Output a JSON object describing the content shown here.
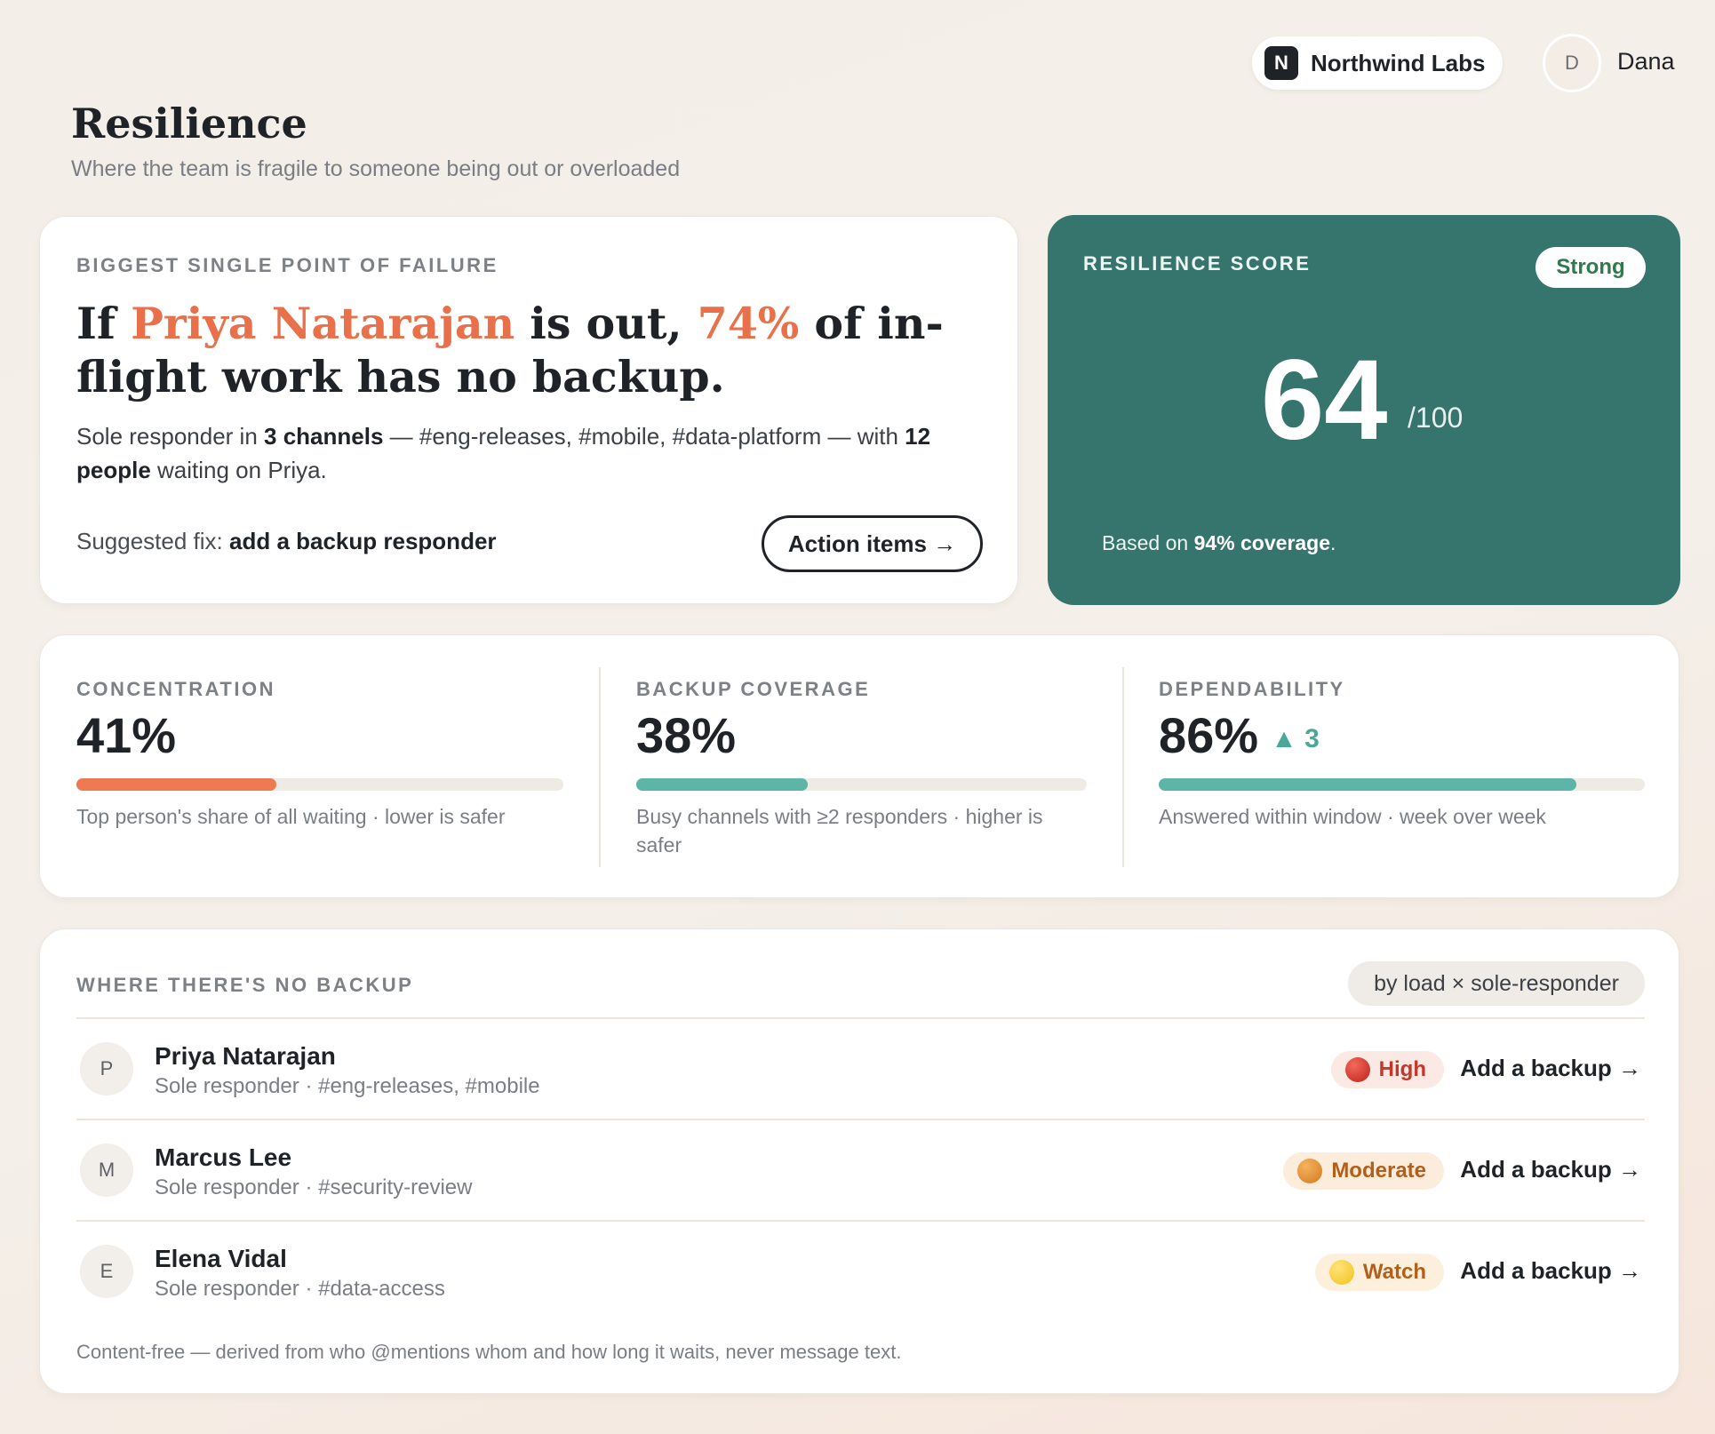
{
  "header": {
    "org_badge": "N",
    "org_name": "Northwind Labs",
    "user_initial": "D",
    "user_name": "Dana"
  },
  "page": {
    "title": "Resilience",
    "subtitle": "Where the team is fragile to someone being out or overloaded"
  },
  "spof": {
    "eyebrow": "Biggest single point of failure",
    "headline_pre": "If ",
    "person": "Priya Natarajan",
    "headline_mid": " is out, ",
    "percent": "74%",
    "headline_post": " of in-flight work has no backup.",
    "detail_1": "Sole responder in ",
    "detail_channels_count": "3 channels",
    "detail_2": " — #eng-releases, #mobile, #data-platform — with ",
    "detail_people": "12 people",
    "detail_3": " waiting on Priya.",
    "fix_label": "Suggested fix: ",
    "fix_value": "add a backup responder",
    "action_label": "Action items →"
  },
  "score": {
    "eyebrow": "Resilience score",
    "badge": "Strong",
    "value": "64",
    "max": "/100",
    "note_pre": "Based on ",
    "note_value": "94% coverage",
    "note_post": "."
  },
  "metrics": [
    {
      "label": "Concentration",
      "value": "41%",
      "delta": "",
      "fill": 0.41,
      "color": "#ee7a52",
      "desc": "Top person's share of all waiting · lower is safer"
    },
    {
      "label": "Backup coverage",
      "value": "38%",
      "delta": "",
      "fill": 0.38,
      "color": "#5db5a7",
      "desc": "Busy channels with ≥2 responders · higher is safer"
    },
    {
      "label": "Dependability",
      "value": "86%",
      "delta": "▲ 3",
      "fill": 0.86,
      "color": "#5db5a7",
      "desc": "Answered within window · week over week"
    }
  ],
  "no_backup": {
    "eyebrow": "Where there's no backup",
    "sort_label": "by load × sole-responder",
    "rows": [
      {
        "initial": "P",
        "name": "Priya Natarajan",
        "sub": "Sole responder · #eng-releases, #mobile",
        "risk": "High",
        "risk_color": "#c0392b",
        "action": "Add a backup →"
      },
      {
        "initial": "M",
        "name": "Marcus Lee",
        "sub": "Sole responder · #security-review",
        "risk": "Moderate",
        "risk_color": "#b35f1a",
        "action": "Add a backup →"
      },
      {
        "initial": "E",
        "name": "Elena Vidal",
        "sub": "Sole responder · #data-access",
        "risk": "Watch",
        "risk_color": "#b35f1a",
        "action": "Add a backup →"
      }
    ],
    "footnote": "Content-free — derived from who @mentions whom and how long it waits, never message text."
  }
}
